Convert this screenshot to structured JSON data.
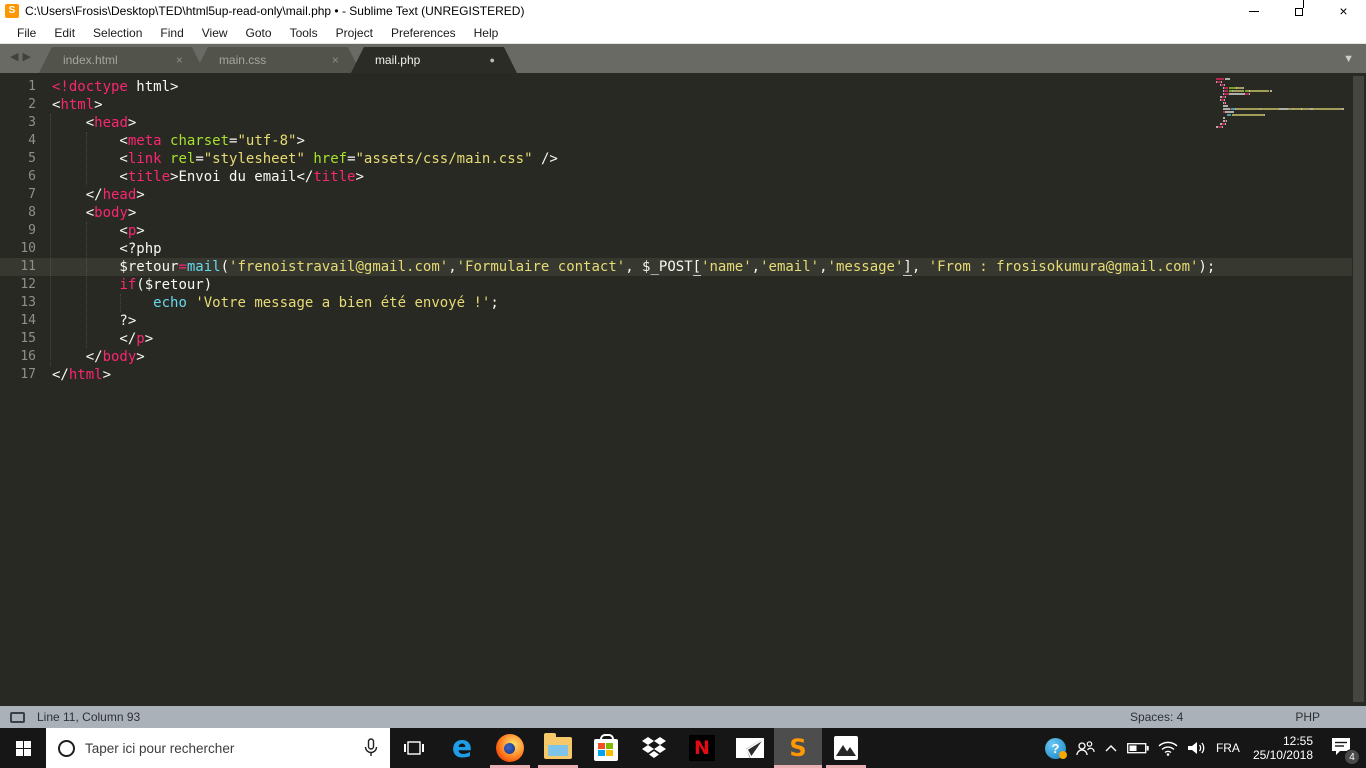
{
  "window": {
    "title": "C:\\Users\\Frosis\\Desktop\\TED\\html5up-read-only\\mail.php • - Sublime Text (UNREGISTERED)",
    "app_icon_glyph": "S"
  },
  "menu": {
    "items": [
      "File",
      "Edit",
      "Selection",
      "Find",
      "View",
      "Goto",
      "Tools",
      "Project",
      "Preferences",
      "Help"
    ]
  },
  "tabbar": {
    "nav_left": "◀",
    "nav_right": "▶",
    "overflow": "▼",
    "tabs": [
      {
        "label": "index.html",
        "state": "inactive",
        "indicator": "×"
      },
      {
        "label": "main.css",
        "state": "inactive",
        "indicator": "×"
      },
      {
        "label": "mail.php",
        "state": "active",
        "indicator": "●"
      }
    ]
  },
  "editor": {
    "current_line": 11,
    "palette": {
      "w": "#f8f8f2",
      "p": "#f92672",
      "g": "#a6e22e",
      "y": "#e6db74",
      "c": "#66d9ef",
      "u": "#f8f8f2"
    },
    "lines": [
      {
        "num": 1,
        "tokens": [
          [
            "p",
            "<!doctype"
          ],
          [
            "w",
            " html>"
          ]
        ]
      },
      {
        "num": 2,
        "tokens": [
          [
            "w",
            "<"
          ],
          [
            "p",
            "html"
          ],
          [
            "w",
            ">"
          ]
        ]
      },
      {
        "num": 3,
        "tokens": [
          [
            "w",
            "    <"
          ],
          [
            "p",
            "head"
          ],
          [
            "w",
            ">"
          ]
        ]
      },
      {
        "num": 4,
        "tokens": [
          [
            "w",
            "        <"
          ],
          [
            "p",
            "meta"
          ],
          [
            "w",
            " "
          ],
          [
            "g",
            "charset"
          ],
          [
            "w",
            "="
          ],
          [
            "y",
            "\"utf-8\""
          ],
          [
            "w",
            ">"
          ]
        ]
      },
      {
        "num": 5,
        "tokens": [
          [
            "w",
            "        <"
          ],
          [
            "p",
            "link"
          ],
          [
            "w",
            " "
          ],
          [
            "g",
            "rel"
          ],
          [
            "w",
            "="
          ],
          [
            "y",
            "\"stylesheet\""
          ],
          [
            "w",
            " "
          ],
          [
            "g",
            "href"
          ],
          [
            "w",
            "="
          ],
          [
            "y",
            "\"assets/css/main.css\""
          ],
          [
            "w",
            " />"
          ]
        ]
      },
      {
        "num": 6,
        "tokens": [
          [
            "w",
            "        <"
          ],
          [
            "p",
            "title"
          ],
          [
            "w",
            ">Envoi du email</"
          ],
          [
            "p",
            "title"
          ],
          [
            "w",
            ">"
          ]
        ]
      },
      {
        "num": 7,
        "tokens": [
          [
            "w",
            "    </"
          ],
          [
            "p",
            "head"
          ],
          [
            "w",
            ">"
          ]
        ]
      },
      {
        "num": 8,
        "tokens": [
          [
            "w",
            "    <"
          ],
          [
            "p",
            "body"
          ],
          [
            "w",
            ">"
          ]
        ]
      },
      {
        "num": 9,
        "tokens": [
          [
            "w",
            "        <"
          ],
          [
            "p",
            "p"
          ],
          [
            "w",
            ">"
          ]
        ]
      },
      {
        "num": 10,
        "tokens": [
          [
            "w",
            "        <?php"
          ]
        ]
      },
      {
        "num": 11,
        "tokens": [
          [
            "w",
            "        $retour"
          ],
          [
            "p",
            "="
          ],
          [
            "c",
            "mail"
          ],
          [
            "w",
            "("
          ],
          [
            "y",
            "'frenoistravail@gmail.com'"
          ],
          [
            "w",
            ","
          ],
          [
            "y",
            "'Formulaire contact'"
          ],
          [
            "w",
            ", $_POST"
          ],
          [
            "u",
            "["
          ],
          [
            "y",
            "'name'"
          ],
          [
            "w",
            ","
          ],
          [
            "y",
            "'email'"
          ],
          [
            "w",
            ","
          ],
          [
            "y",
            "'message'"
          ],
          [
            "u",
            "]"
          ],
          [
            "w",
            ", "
          ],
          [
            "y",
            "'From : frosisokumura@gmail.com'"
          ],
          [
            "w",
            ");"
          ]
        ]
      },
      {
        "num": 12,
        "tokens": [
          [
            "w",
            "        "
          ],
          [
            "p",
            "if"
          ],
          [
            "w",
            "($retour)"
          ]
        ]
      },
      {
        "num": 13,
        "tokens": [
          [
            "w",
            "            "
          ],
          [
            "c",
            "echo"
          ],
          [
            "w",
            " "
          ],
          [
            "y",
            "'Votre message a bien été envoyé !'"
          ],
          [
            "w",
            ";"
          ]
        ]
      },
      {
        "num": 14,
        "tokens": [
          [
            "w",
            "        ?>"
          ]
        ]
      },
      {
        "num": 15,
        "tokens": [
          [
            "w",
            "        </"
          ],
          [
            "p",
            "p"
          ],
          [
            "w",
            ">"
          ]
        ]
      },
      {
        "num": 16,
        "tokens": [
          [
            "w",
            "    </"
          ],
          [
            "p",
            "body"
          ],
          [
            "w",
            ">"
          ]
        ]
      },
      {
        "num": 17,
        "tokens": [
          [
            "w",
            "</"
          ],
          [
            "p",
            "html"
          ],
          [
            "w",
            ">"
          ]
        ]
      }
    ]
  },
  "status_bar": {
    "position": "Line 11, Column 93",
    "spaces": "Spaces: 4",
    "syntax": "PHP"
  },
  "taskbar": {
    "search_placeholder": "Taper ici pour rechercher",
    "apps": [
      {
        "name": "edge",
        "running": false,
        "active": false,
        "glyph": "e"
      },
      {
        "name": "firefox",
        "running": true,
        "active": false,
        "glyph": ""
      },
      {
        "name": "explorer",
        "running": true,
        "active": false,
        "glyph": ""
      },
      {
        "name": "store",
        "running": false,
        "active": false,
        "glyph": ""
      },
      {
        "name": "dropbox",
        "running": false,
        "active": false,
        "glyph": ""
      },
      {
        "name": "netflix",
        "running": false,
        "active": false,
        "glyph": "N"
      },
      {
        "name": "mail",
        "running": false,
        "active": false,
        "glyph": ""
      },
      {
        "name": "sublime",
        "running": true,
        "active": true,
        "glyph": "S"
      },
      {
        "name": "photos",
        "running": true,
        "active": false,
        "glyph": ""
      }
    ],
    "tray": {
      "help_glyph": "?",
      "language": "FRA",
      "time": "12:55",
      "date": "25/10/2018",
      "notification_count": "4"
    }
  }
}
